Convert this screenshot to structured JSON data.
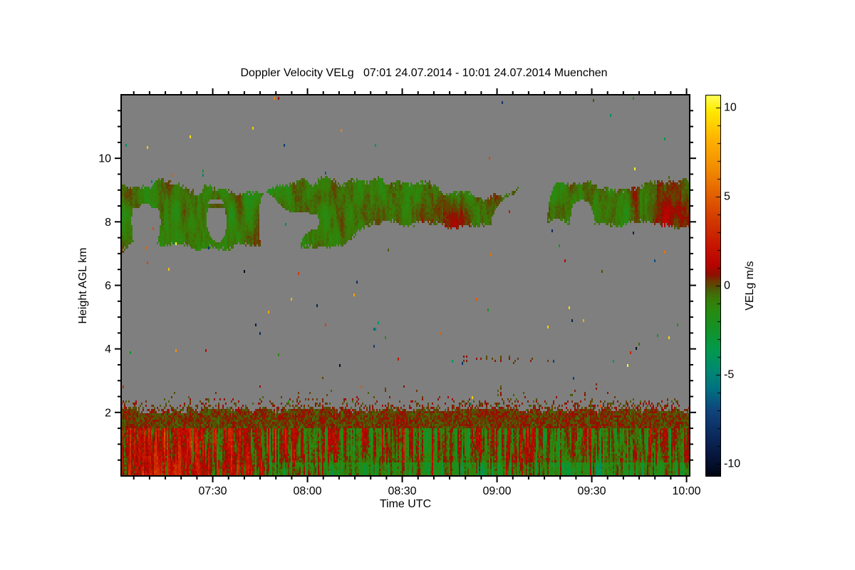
{
  "figure": {
    "background": "#ffffff"
  },
  "chart_data": {
    "type": "heatmap",
    "title": "Doppler Velocity VELg   07:01 24.07.2014 - 10:01 24.07.2014 Muenchen",
    "xlabel": "Time UTC",
    "ylabel": "Height AGL km",
    "colorbar_label": "VELg m/s",
    "x_start": "07:01",
    "x_end": "10:01",
    "x_ticks": [
      "07:30",
      "08:00",
      "08:30",
      "09:00",
      "09:30",
      "10:00"
    ],
    "x_minor_step_min": 5,
    "y_range_km": [
      0,
      12
    ],
    "y_ticks": [
      2,
      4,
      6,
      8,
      10
    ],
    "y_minor_step_km": 0.5,
    "colorbar": {
      "range": [
        -10.68,
        10.68
      ],
      "ticks": [
        10,
        5,
        0,
        -5,
        -10
      ],
      "minor_step": 1
    },
    "nodata_color": "#7f7f7f",
    "colormap_stops": [
      [
        10.7,
        "#ffff55"
      ],
      [
        9.8,
        "#ffea00"
      ],
      [
        8.2,
        "#ffb300"
      ],
      [
        6.5,
        "#f28a00"
      ],
      [
        5.0,
        "#e25e00"
      ],
      [
        3.6,
        "#d13800"
      ],
      [
        2.2,
        "#c61500"
      ],
      [
        1.2,
        "#b80400"
      ],
      [
        0.6,
        "#901000"
      ],
      [
        0.25,
        "#6b3a00"
      ],
      [
        0.0,
        "#5c4a00"
      ],
      [
        -0.25,
        "#49600a"
      ],
      [
        -0.7,
        "#3a7a06"
      ],
      [
        -1.3,
        "#2a8a10"
      ],
      [
        -2.4,
        "#149226"
      ],
      [
        -3.6,
        "#039a4e"
      ],
      [
        -4.7,
        "#008a70"
      ],
      [
        -5.8,
        "#007282"
      ],
      [
        -7.0,
        "#10457c"
      ],
      [
        -8.4,
        "#0c2a5e"
      ],
      [
        -9.6,
        "#07163c"
      ],
      [
        -10.4,
        "#020a1e"
      ],
      [
        -10.7,
        "#000410"
      ]
    ],
    "seed": 7,
    "regions": {
      "cloud_band": {
        "top_km": 9.1,
        "bottom_km_early": 7.2,
        "bottom_km_late": 7.9,
        "bottom_transition_min": [
          70,
          80
        ],
        "velocity_range_ms": [
          -2.6,
          1.7
        ],
        "description": "mid-level cloud layer, mostly weak negative Doppler velocity (green/olive mottle) with sporadic warm patches and gray gaps"
      },
      "boundary_layer": {
        "top_km": 2.06,
        "olive_cap_base_km": 1.5,
        "red_dominated_until_min": 64,
        "velocity_range_ms": [
          -5.2,
          4.6
        ],
        "description": "convective boundary layer: red up/downdraft streaks over green; strongly red before ~08:05, green/teal with red plumes later"
      },
      "speckle_fade_above_bl_km": 0.95,
      "artifact_cluster": {
        "t_min": [
          108,
          136
        ],
        "h_km": [
          3.5,
          3.78
        ],
        "density": 0.1
      },
      "global_speckle_density": 0.0015
    }
  }
}
